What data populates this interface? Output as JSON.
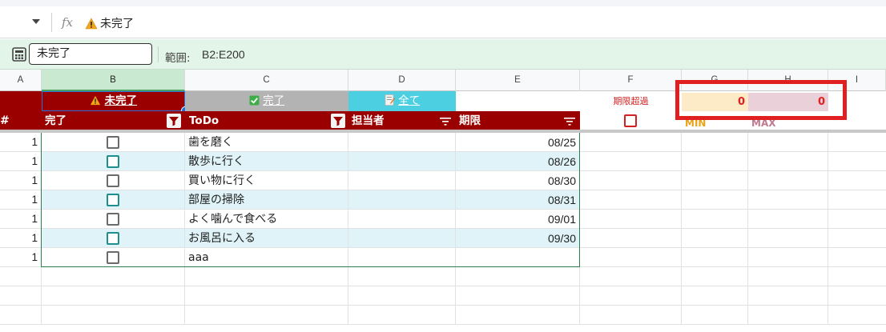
{
  "formula_bar": {
    "cell_value": "未完了",
    "fx_label": "fx"
  },
  "filter_bar": {
    "named_range": "未完了",
    "range_label": "範囲:",
    "range_value": "B2:E200"
  },
  "columns": [
    "A",
    "B",
    "C",
    "D",
    "E",
    "F",
    "G",
    "H",
    "I"
  ],
  "filter_buttons": {
    "incomplete": "未完了",
    "complete": "完了",
    "all": "全て"
  },
  "overdue_label": "期限超過",
  "min_value": "0",
  "max_value": "0",
  "min_label": "MIN",
  "max_label": "MAX",
  "table_headers": {
    "num": "#",
    "done": "完了",
    "todo": "ToDo",
    "assignee": "担当者",
    "deadline": "期限"
  },
  "rows": [
    {
      "num": "1",
      "todo": "歯を磨く",
      "deadline": "08/25"
    },
    {
      "num": "1",
      "todo": "散歩に行く",
      "deadline": "08/26"
    },
    {
      "num": "1",
      "todo": "買い物に行く",
      "deadline": "08/30"
    },
    {
      "num": "1",
      "todo": "部屋の掃除",
      "deadline": "08/31"
    },
    {
      "num": "1",
      "todo": "よく噛んで食べる",
      "deadline": "09/01"
    },
    {
      "num": "1",
      "todo": "お風呂に入る",
      "deadline": "09/30"
    },
    {
      "num": "1",
      "todo": "aaa",
      "deadline": ""
    }
  ],
  "colors": {
    "header_red": "#9b0000",
    "highlight_red": "#e02020",
    "band_teal": "#dff3f8",
    "selected_green": "#c9ead0"
  }
}
